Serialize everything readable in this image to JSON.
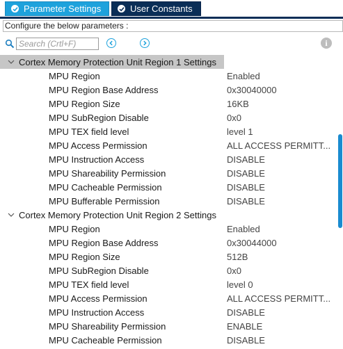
{
  "tabs": [
    {
      "label": "Parameter Settings",
      "active": true
    },
    {
      "label": "User Constants",
      "active": false
    }
  ],
  "configure_text": "Configure the below parameters :",
  "search": {
    "placeholder": "Search (Crtl+F)",
    "value": ""
  },
  "colors": {
    "accent": "#1ea2dc",
    "tab_dark": "#0a2e57",
    "selected_header": "#c6c6c6",
    "scrollbar": "#1a8bd0"
  },
  "groups": [
    {
      "title": "Cortex Memory Protection Unit Region 1 Settings",
      "params": [
        {
          "name": "MPU Region",
          "value": "Enabled"
        },
        {
          "name": "MPU Region Base Address",
          "value": "0x30040000"
        },
        {
          "name": "MPU Region Size",
          "value": "16KB"
        },
        {
          "name": "MPU SubRegion Disable",
          "value": "0x0"
        },
        {
          "name": "MPU TEX field level",
          "value": "level 1"
        },
        {
          "name": "MPU Access Permission",
          "value": "ALL ACCESS PERMITT..."
        },
        {
          "name": "MPU Instruction Access",
          "value": "DISABLE"
        },
        {
          "name": "MPU Shareability Permission",
          "value": "DISABLE"
        },
        {
          "name": "MPU Cacheable Permission",
          "value": "DISABLE"
        },
        {
          "name": "MPU Bufferable  Permission",
          "value": "DISABLE"
        }
      ]
    },
    {
      "title": "Cortex Memory Protection Unit Region 2 Settings",
      "params": [
        {
          "name": "MPU Region",
          "value": "Enabled"
        },
        {
          "name": "MPU Region Base Address",
          "value": "0x30044000"
        },
        {
          "name": "MPU Region Size",
          "value": "512B"
        },
        {
          "name": "MPU SubRegion Disable",
          "value": "0x0"
        },
        {
          "name": "MPU TEX field level",
          "value": "level 0"
        },
        {
          "name": "MPU Access Permission",
          "value": "ALL ACCESS PERMITT..."
        },
        {
          "name": "MPU Instruction Access",
          "value": "DISABLE"
        },
        {
          "name": "MPU Shareability Permission",
          "value": "ENABLE"
        },
        {
          "name": "MPU Cacheable Permission",
          "value": "DISABLE"
        }
      ]
    }
  ]
}
